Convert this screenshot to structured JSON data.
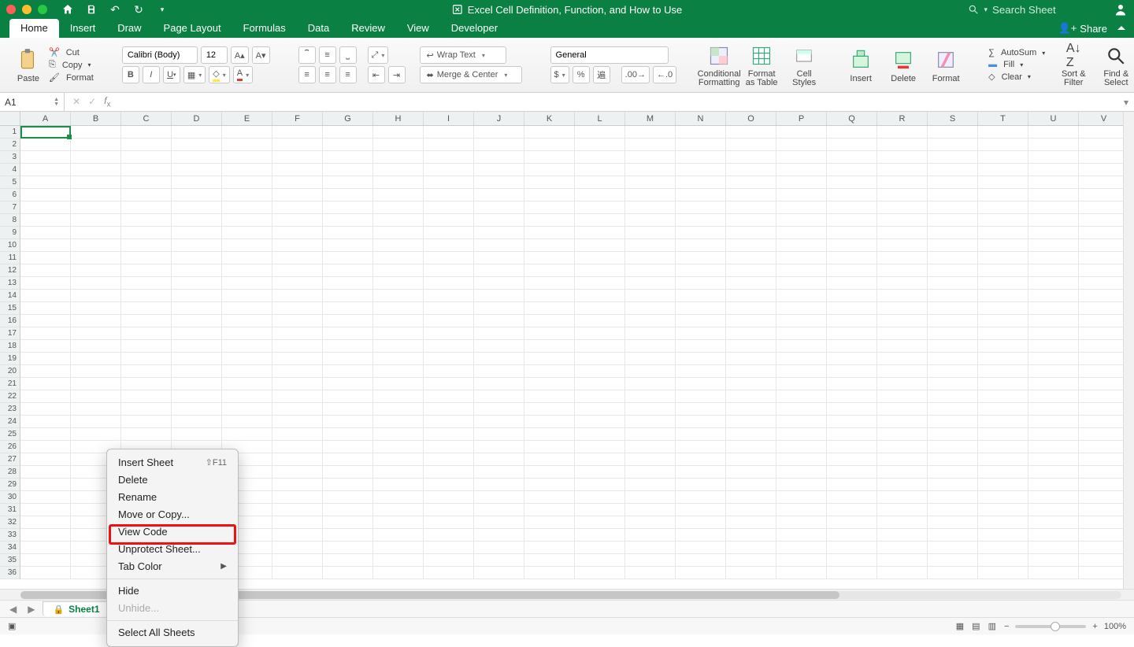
{
  "titlebar": {
    "title": "Excel Cell Definition, Function, and How to Use",
    "search_placeholder": "Search Sheet"
  },
  "tabs": [
    "Home",
    "Insert",
    "Draw",
    "Page Layout",
    "Formulas",
    "Data",
    "Review",
    "View",
    "Developer"
  ],
  "active_tab": "Home",
  "share_label": "Share",
  "clipboard": {
    "paste": "Paste",
    "cut": "Cut",
    "copy": "Copy",
    "format": "Format"
  },
  "font": {
    "name": "Calibri (Body)",
    "size": "12"
  },
  "align": {
    "wrap": "Wrap Text",
    "merge": "Merge & Center"
  },
  "number": {
    "format": "General"
  },
  "styles": {
    "cond": "Conditional Formatting",
    "table": "Format as Table",
    "cell": "Cell Styles"
  },
  "cells": {
    "insert": "Insert",
    "delete": "Delete",
    "format": "Format"
  },
  "editing": {
    "autosum": "AutoSum",
    "fill": "Fill",
    "clear": "Clear",
    "sort": "Sort & Filter",
    "find": "Find & Select"
  },
  "namebox": "A1",
  "columns": [
    "A",
    "B",
    "C",
    "D",
    "E",
    "F",
    "G",
    "H",
    "I",
    "J",
    "K",
    "L",
    "M",
    "N",
    "O",
    "P",
    "Q",
    "R",
    "S",
    "T",
    "U",
    "V"
  ],
  "row_count": 36,
  "sheet": {
    "name": "Sheet1"
  },
  "context_menu": {
    "insert_sheet": "Insert Sheet",
    "insert_sheet_shortcut": "⇧F11",
    "delete": "Delete",
    "rename": "Rename",
    "move_copy": "Move or Copy...",
    "view_code": "View Code",
    "unprotect": "Unprotect Sheet...",
    "tab_color": "Tab Color",
    "hide": "Hide",
    "unhide": "Unhide...",
    "select_all": "Select All Sheets"
  },
  "status": {
    "zoom": "100%"
  }
}
